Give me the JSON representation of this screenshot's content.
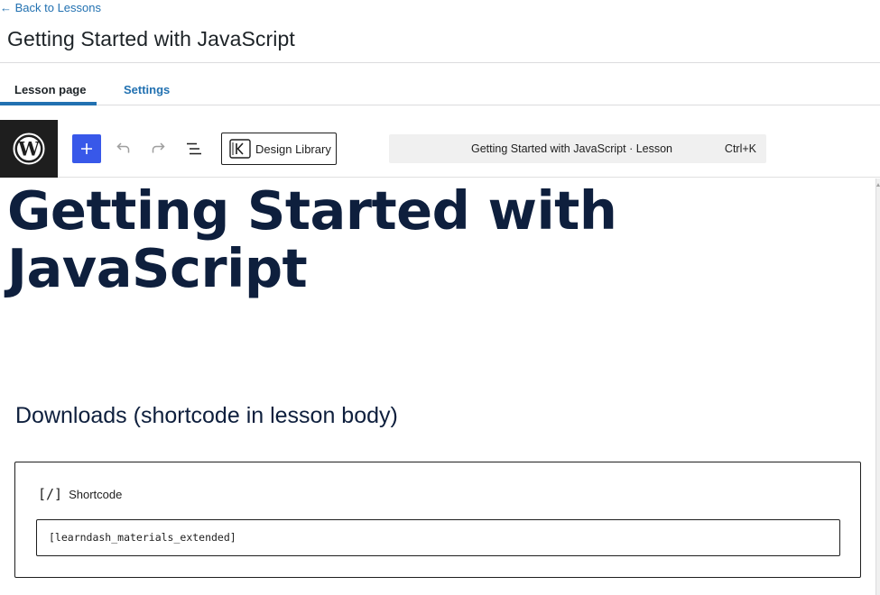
{
  "header": {
    "back_link": "← Back to Lessons",
    "title": "Getting Started with JavaScript"
  },
  "tabs": [
    {
      "label": "Lesson page",
      "active": true
    },
    {
      "label": "Settings",
      "active": false
    }
  ],
  "toolbar": {
    "logo_icon": "wordpress-logo-icon",
    "add_block_icon": "plus-icon",
    "undo_icon": "undo-icon",
    "redo_icon": "redo-icon",
    "list_view_icon": "list-view-icon",
    "design_library_label": "Design Library",
    "command_bar": {
      "title": "Getting Started with JavaScript · Lesson",
      "shortcut": "Ctrl+K"
    }
  },
  "content": {
    "post_title": "Getting Started with JavaScript",
    "section_heading": "Downloads (shortcode in lesson body)",
    "shortcode_block": {
      "icon_text": "[/]",
      "label": "Shortcode",
      "value": "[learndash_materials_extended]"
    }
  },
  "colors": {
    "accent": "#2271b1",
    "add_button": "#3858e9",
    "title_text": "#0e1f3d",
    "logo_bg": "#1e1e1e"
  }
}
